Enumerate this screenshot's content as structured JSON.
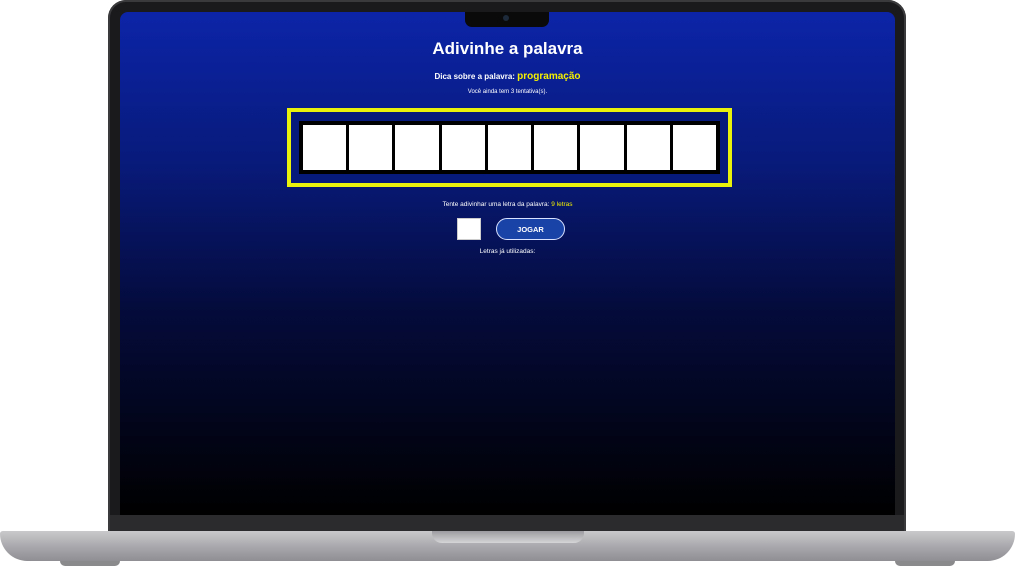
{
  "game": {
    "title": "Adivinhe a palavra",
    "hint_label": "Dica sobre a palavra:",
    "hint_word": "programação",
    "attempts_text": "Você ainda tem 3 tentativa(s).",
    "guess_prompt": "Tente adivinhar uma letra da palavra:",
    "letter_count_text": "9 letras",
    "letter_slots": 9,
    "letter_input_value": "",
    "play_button_label": "JOGAR",
    "used_letters_label": "Letras já utilizadas:"
  },
  "colors": {
    "accent_yellow": "#f4f000",
    "button_blue": "#1a43a8",
    "background_top": "#0c24a8",
    "background_bottom": "#000000"
  }
}
